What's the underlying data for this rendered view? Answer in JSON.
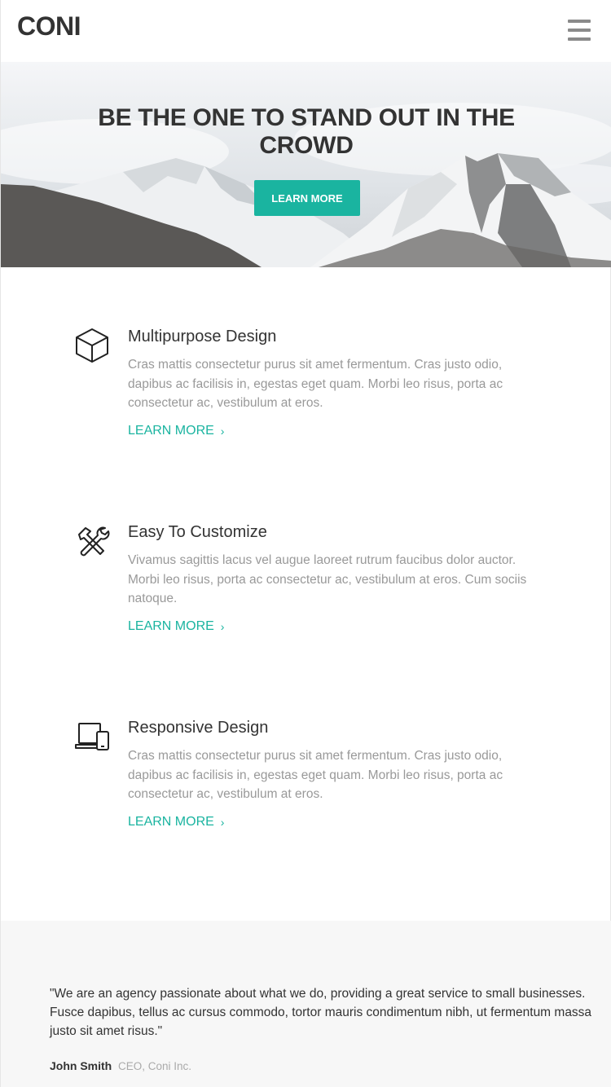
{
  "header": {
    "logo": "CONI",
    "menu_icon": "hamburger-icon"
  },
  "hero": {
    "title": "BE THE ONE TO STAND OUT IN THE CROWD",
    "button_label": "LEARN MORE"
  },
  "features": [
    {
      "icon": "cube-icon",
      "title": "Multipurpose Design",
      "description": "Cras mattis consectetur purus sit amet fermentum. Cras justo odio, dapibus ac facilisis in, egestas eget quam. Morbi leo risus, porta ac consectetur ac, vestibulum at eros.",
      "link": "LEARN MORE",
      "link_icon": "chevron-right-icon"
    },
    {
      "icon": "tools-icon",
      "title": "Easy To Customize",
      "description": "Vivamus sagittis lacus vel augue laoreet rutrum faucibus dolor auctor. Morbi leo risus, porta ac consectetur ac, vestibulum at eros. Cum sociis natoque.",
      "link": "LEARN MORE",
      "link_icon": "chevron-right-icon"
    },
    {
      "icon": "devices-icon",
      "title": "Responsive Design",
      "description": "Cras mattis consectetur purus sit amet fermentum. Cras justo odio, dapibus ac facilisis in, egestas eget quam. Morbi leo risus, porta ac consectetur ac, vestibulum at eros.",
      "link": "LEARN MORE",
      "link_icon": "chevron-right-icon"
    }
  ],
  "testimonial": {
    "quote": "\"We are an agency passionate about what we do, providing a great service to small businesses. Fusce dapibus, tellus ac cursus commodo, tortor mauris condimentum nibh, ut fermentum massa justo sit amet risus.\"",
    "author": "John Smith",
    "role": "CEO, Coni Inc."
  },
  "colors": {
    "accent": "#1ab4a0",
    "text": "#333333",
    "muted": "#999999"
  }
}
